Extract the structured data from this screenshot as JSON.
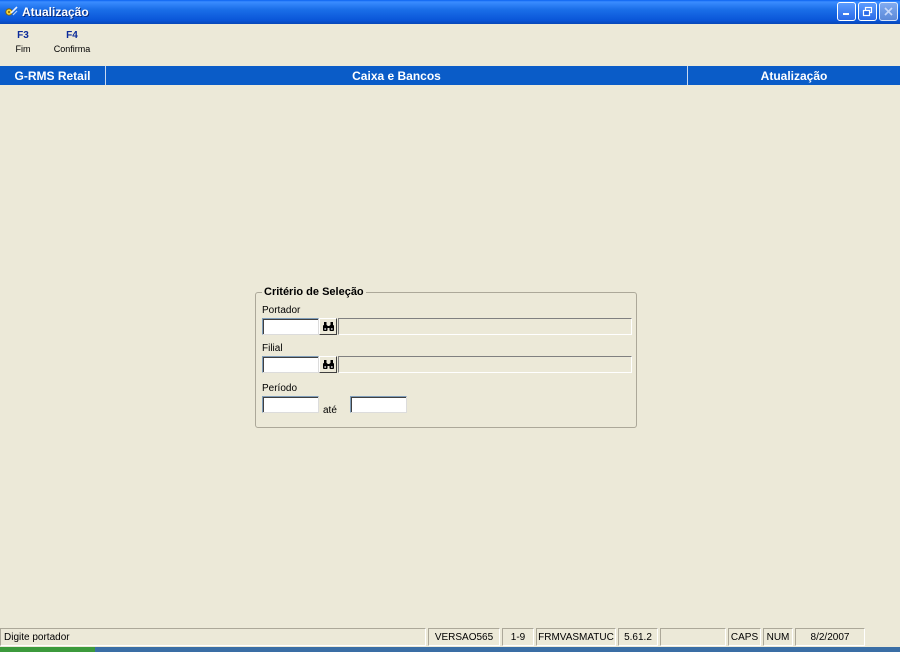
{
  "window": {
    "title": "Atualização",
    "icon": "app-gear-icon"
  },
  "toolbar": {
    "keys": [
      {
        "key": "F3",
        "label": "Fim"
      },
      {
        "key": "F4",
        "label": "Confirma"
      }
    ]
  },
  "header": {
    "app_name": "G-RMS Retail",
    "module": "Caixa e Bancos",
    "screen": "Atualização"
  },
  "criteria": {
    "title": "Critério de Seleção",
    "portador": {
      "label": "Portador",
      "value": "",
      "lookup_icon": "binoculars-icon",
      "description": ""
    },
    "filial": {
      "label": "Filial",
      "value": "",
      "lookup_icon": "binoculars-icon",
      "description": ""
    },
    "periodo": {
      "label": "Período",
      "from": "",
      "separator": "até",
      "to": ""
    }
  },
  "statusbar": {
    "message": "Digite portador",
    "version": "VERSAO565",
    "page": "1-9",
    "form": "FRMVASMATUC",
    "build": "5.61.2",
    "blank": "",
    "caps": "CAPS",
    "num": "NUM",
    "date": "8/2/2007"
  },
  "colors": {
    "titlebar": "#0a55d8",
    "header_band": "#0a5cc8",
    "window_bg": "#ece9d8",
    "fkey_text": "#0a2a9a"
  }
}
